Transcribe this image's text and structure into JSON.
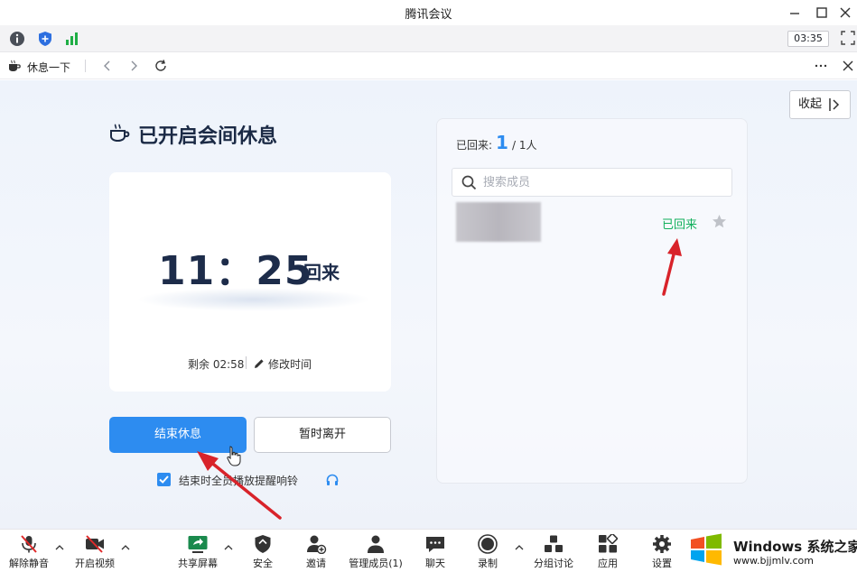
{
  "window": {
    "title": "腾讯会议"
  },
  "status_bar": {
    "clock": "03:35"
  },
  "nav": {
    "title": "休息一下"
  },
  "break_panel": {
    "heading": "已开启会间休息",
    "timer": "11：25",
    "timer_suffix": "回来",
    "remaining": "剩余 02:58",
    "edit_time": "修改时间",
    "end_button": "结束休息",
    "leave_button": "暂时离开",
    "checkbox_label": "结束时全员播放提醒响铃",
    "checkbox_checked": true
  },
  "collapse_button": "收起",
  "members": {
    "returned_label": "已回来:",
    "returned_count": "1",
    "total": "/ 1人",
    "search_placeholder": "搜索成员",
    "list": [
      {
        "status": "已回来"
      }
    ]
  },
  "toolbar": {
    "items": [
      {
        "label": "解除静音",
        "icon": "mic-muted-icon"
      },
      {
        "label": "开启视频",
        "icon": "video-off-icon"
      },
      {
        "label": "共享屏幕",
        "icon": "share-screen-icon"
      },
      {
        "label": "安全",
        "icon": "shield-icon"
      },
      {
        "label": "邀请",
        "icon": "invite-icon"
      },
      {
        "label": "管理成员(1)",
        "icon": "members-icon"
      },
      {
        "label": "聊天",
        "icon": "chat-icon"
      },
      {
        "label": "录制",
        "icon": "record-icon"
      },
      {
        "label": "分组讨论",
        "icon": "breakout-icon"
      },
      {
        "label": "应用",
        "icon": "apps-icon"
      },
      {
        "label": "设置",
        "icon": "settings-icon"
      }
    ]
  },
  "watermark": {
    "brand": "Windows",
    "brand_cn": "系统之家",
    "url": "www.bjjmlv.com"
  },
  "colors": {
    "accent": "#2d8cf0",
    "success": "#12b05c",
    "annotation": "#d8232a"
  }
}
